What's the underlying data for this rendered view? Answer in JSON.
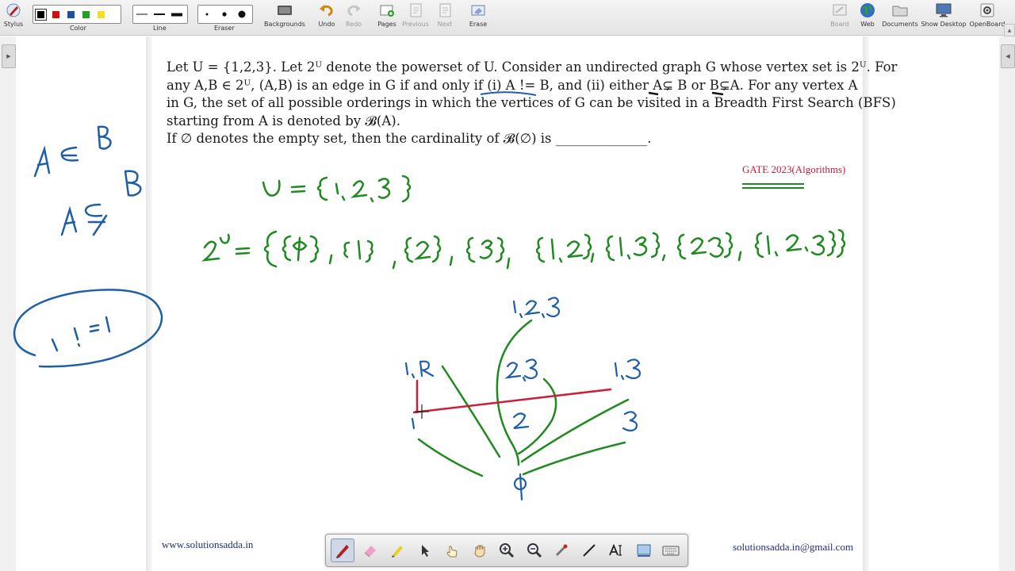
{
  "toolbar": {
    "stylus": "Stylus",
    "color": "Color",
    "line": "Line",
    "eraser": "Eraser",
    "backgrounds": "Backgrounds",
    "undo": "Undo",
    "redo": "Redo",
    "pages": "Pages",
    "previous": "Previous",
    "next": "Next",
    "erase": "Erase",
    "board": "Board",
    "web": "Web",
    "documents": "Documents",
    "show_desktop": "Show Desktop",
    "openboard": "OpenBoard"
  },
  "colors": {
    "swatches": [
      "#000000",
      "#cc1111",
      "#1f4f9f",
      "#22a022",
      "#f0e020"
    ],
    "ink_green": "#1f8a1f",
    "ink_blue": "#1e5fa8",
    "ink_red": "#cc1f3a",
    "gate_red": "#c0203c",
    "footer_blue": "#1f2f7a"
  },
  "question": {
    "line1": "Let U = {1,2,3}. Let 2ᵁ denote the powerset of U. Consider an undirected graph G whose vertex set is 2ᵁ. For",
    "line2": "any A,B ∈ 2ᵁ, (A,B) is an edge in G if and only if (i) A != B, and (ii) either A⊊ B   or B⊊A. For any vertex A",
    "line3": "in G, the set of all possible orderings in which the vertices of G can be visited in a Breadth First Search (BFS)",
    "line4": "starting from A is denoted by  𝓑(A).",
    "line5": "If ∅ denotes the empty set, then the cardinality of  𝓑(∅)  is ______________."
  },
  "annotations": {
    "source": "GATE 2023(Algorithms)",
    "hw_a_subset_b": "A ⊂ B",
    "hw_a_not_subseteq_b": "A ⊊ B",
    "hw_one_ne_one": "1 != 1",
    "hw_universe": "U = {1,2,3}",
    "hw_powerset": "2ᵁ = {{ϕ}, {1}, {2}, {3}, {1,2}, {1,3}, {2,3}, {1,2,3}}",
    "graph_nodes": [
      "1,2,3",
      "1,2",
      "2,3",
      "1,3",
      "1",
      "2",
      "3",
      "ϕ"
    ]
  },
  "footer": {
    "website": "www.solutionsadda.in",
    "email": "solutionsadda.in@gmail.com"
  },
  "palette_tools": [
    "pen-tool",
    "eraser-tool",
    "marker-tool",
    "selector-tool",
    "interact-tool",
    "hand-tool",
    "zoom-in-tool",
    "zoom-out-tool",
    "laser-pointer-tool",
    "line-tool",
    "text-tool",
    "capture-tool",
    "virtual-keyboard-tool"
  ]
}
